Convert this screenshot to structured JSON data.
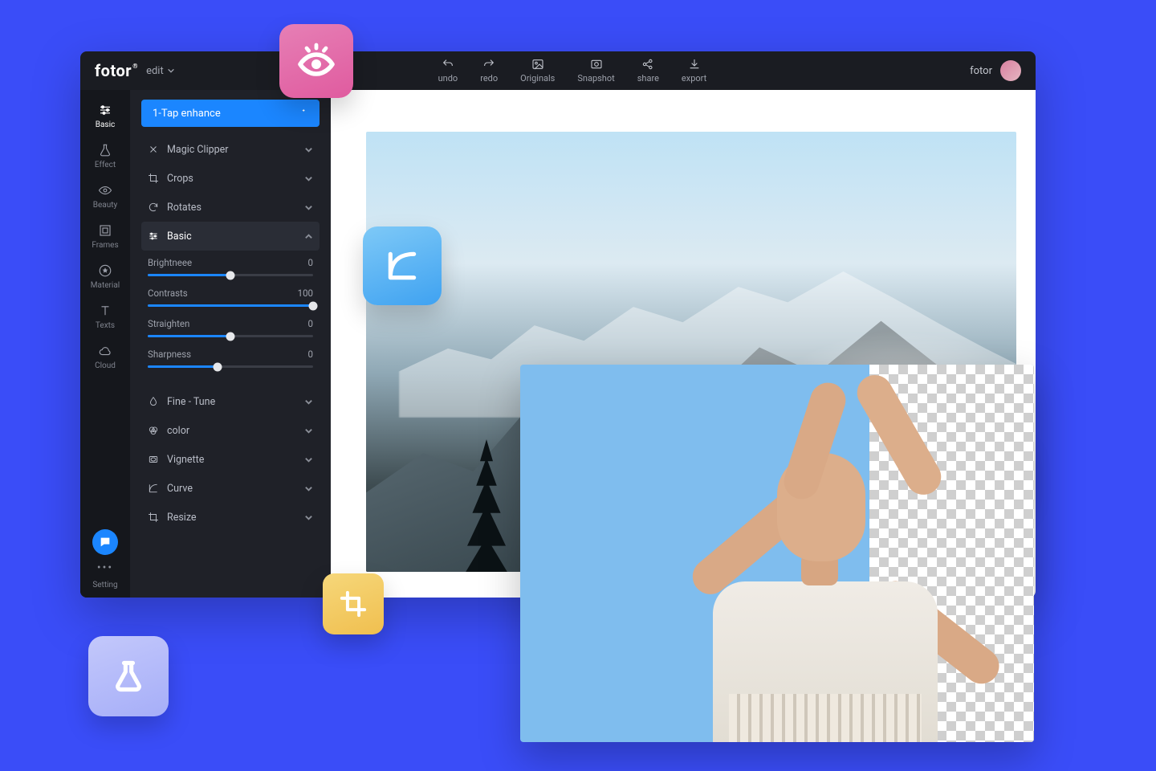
{
  "header": {
    "logo": "fotor",
    "edit_menu": "edit",
    "buttons": {
      "undo": "undo",
      "redo": "redo",
      "originals": "Originals",
      "snapshot": "Snapshot",
      "share": "share",
      "export": "export"
    },
    "user_label": "fotor"
  },
  "siderail": {
    "items": [
      "Basic",
      "Effect",
      "Beauty",
      "Frames",
      "Material",
      "Texts",
      "Cloud"
    ],
    "setting": "Setting"
  },
  "panel": {
    "enhance": "1-Tap enhance",
    "sections": {
      "magic_clipper": "Magic Clipper",
      "crops": "Crops",
      "rotates": "Rotates",
      "basic": "Basic",
      "fine_tune": "Fine - Tune",
      "color": "color",
      "vignette": "Vignette",
      "curve": "Curve",
      "resize": "Resize"
    },
    "sliders": {
      "brightness": {
        "label": "Brightneee",
        "value": 0,
        "pct": 50
      },
      "contrasts": {
        "label": "Contrasts",
        "value": 100,
        "pct": 100
      },
      "straighten": {
        "label": "Straighten",
        "value": 0,
        "pct": 50
      },
      "sharpness": {
        "label": "Sharpness",
        "value": 0,
        "pct": 42
      }
    }
  },
  "floats": {
    "eye": "preview-icon",
    "curve": "curve-icon",
    "crop": "crop-icon",
    "pattern": "pattern-icon",
    "flask": "flask-icon"
  }
}
